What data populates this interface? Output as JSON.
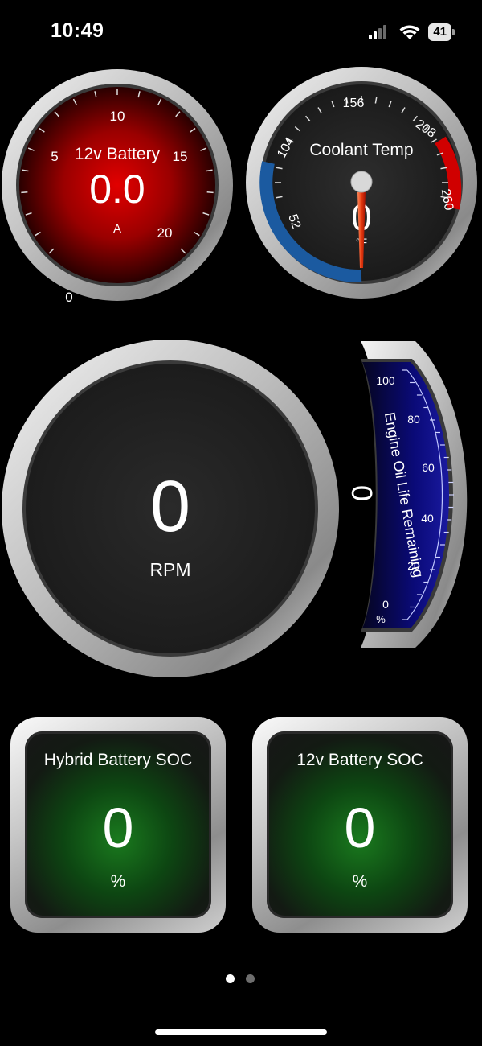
{
  "status_bar": {
    "time": "10:49",
    "battery": "41"
  },
  "gauges": {
    "battery_12v": {
      "title": "12v Battery",
      "value": "0.0",
      "unit": "A",
      "ticks": [
        "0",
        "5",
        "10",
        "15",
        "20"
      ]
    },
    "coolant": {
      "title": "Coolant Temp",
      "value": "0",
      "unit": "°F",
      "ticks": [
        "52",
        "104",
        "156",
        "208",
        "260"
      ]
    },
    "rpm": {
      "value": "0",
      "label": "RPM"
    },
    "oil_life": {
      "title": "Engine Oil Life Remaining",
      "value": "0",
      "unit": "%",
      "ticks": [
        "0",
        "20",
        "40",
        "60",
        "80",
        "100"
      ]
    }
  },
  "tiles": {
    "hybrid_soc": {
      "title": "Hybrid Battery SOC",
      "value": "0",
      "unit": "%"
    },
    "battery_soc": {
      "title": "12v Battery SOC",
      "value": "0",
      "unit": "%"
    }
  },
  "pager": {
    "page": 1,
    "count": 2
  },
  "colors": {
    "red_dial": "#b00000",
    "blue_band": "#1b5aa0",
    "red_band": "#d00000",
    "green_glow": "#1a7a1e",
    "oil_blue": "#0a0a8a"
  }
}
